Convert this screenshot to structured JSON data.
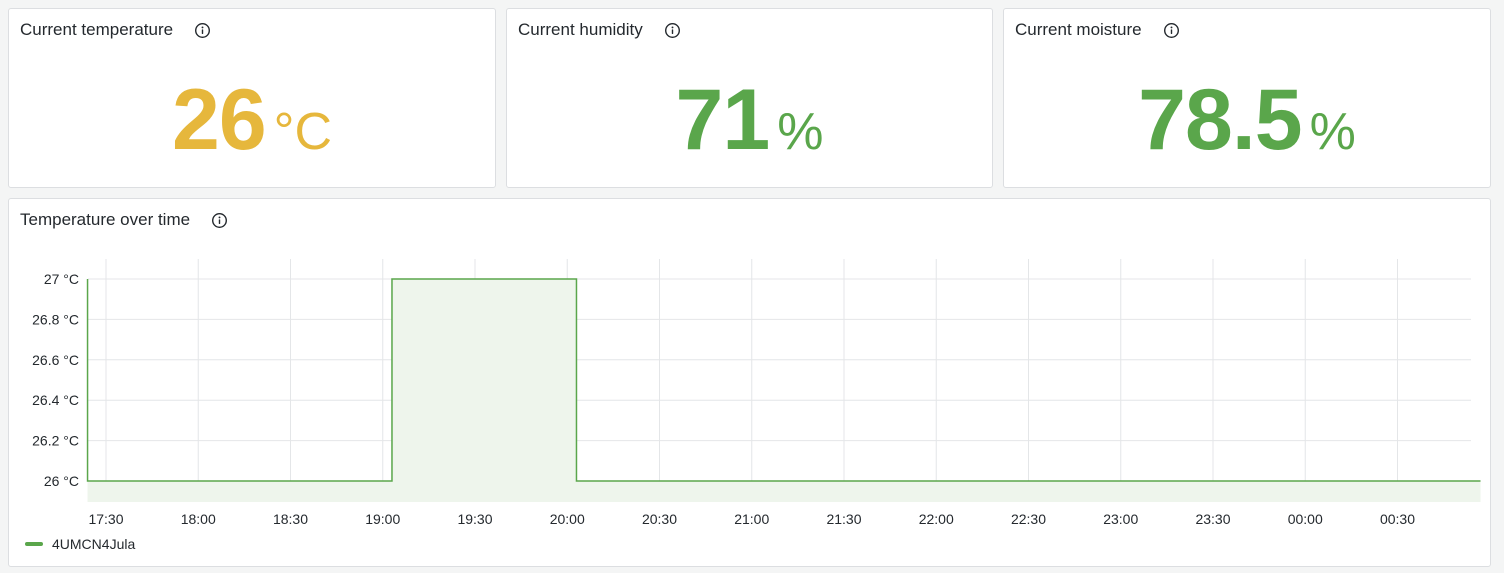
{
  "colors": {
    "yellow": "#e6b73c",
    "green": "#5aa64b",
    "fill": "#eef5ec",
    "grid": "#e4e6e8"
  },
  "stats": [
    {
      "title": "Current temperature",
      "value": "26",
      "unit": "°C",
      "color": "#e6b73c"
    },
    {
      "title": "Current humidity",
      "value": "71",
      "unit": "%",
      "color": "#5aa64b"
    },
    {
      "title": "Current moisture",
      "value": "78.5",
      "unit": "%",
      "color": "#5aa64b"
    }
  ],
  "chart": {
    "title": "Temperature over time"
  },
  "chart_data": {
    "type": "line",
    "title": "Temperature over time",
    "x_ticks": [
      "17:30",
      "18:00",
      "18:30",
      "19:00",
      "19:30",
      "20:00",
      "20:30",
      "21:00",
      "21:30",
      "22:00",
      "22:30",
      "23:00",
      "23:30",
      "00:00",
      "00:30"
    ],
    "y_ticks": [
      "27 °C",
      "26.8 °C",
      "26.6 °C",
      "26.4 °C",
      "26.2 °C",
      "26 °C"
    ],
    "ylim": [
      26,
      27
    ],
    "interpolation": "step",
    "series": [
      {
        "name": "4UMCN4Jula",
        "color": "#5aa64b",
        "points": [
          {
            "t": "17:24",
            "v": 27
          },
          {
            "t": "17:24",
            "v": 26
          },
          {
            "t": "19:03",
            "v": 26
          },
          {
            "t": "19:03",
            "v": 27
          },
          {
            "t": "20:03",
            "v": 27
          },
          {
            "t": "20:03",
            "v": 26
          },
          {
            "t": "00:57",
            "v": 26
          }
        ]
      }
    ],
    "legend": "bottom-left",
    "grid": true
  }
}
